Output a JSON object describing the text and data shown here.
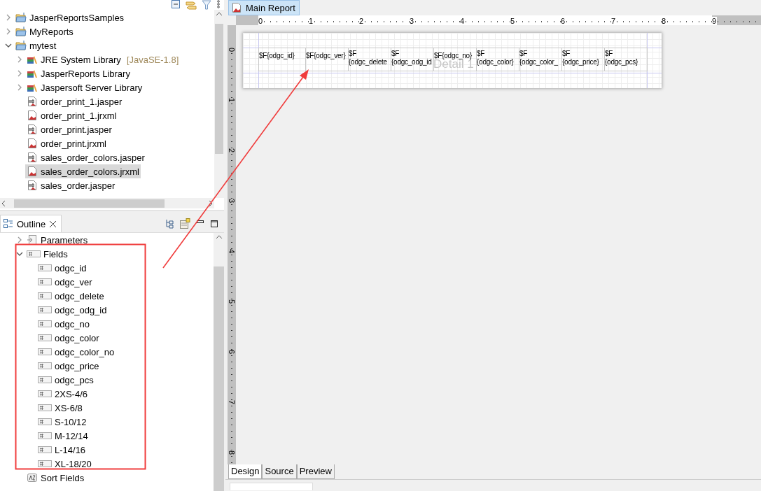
{
  "explorer": {
    "items": [
      {
        "label": "JasperReportsSamples",
        "kind": "folder",
        "expanded": false,
        "selected": false
      },
      {
        "label": "MyReports",
        "kind": "folder",
        "expanded": false,
        "selected": false
      },
      {
        "label": "mytest",
        "kind": "folder",
        "expanded": true,
        "selected": false,
        "children": [
          {
            "label": "JRE System Library",
            "decoration": "[JavaSE-1.8]",
            "kind": "library",
            "expanded": false,
            "selected": false
          },
          {
            "label": "JasperReports Library",
            "kind": "library",
            "expanded": false,
            "selected": false
          },
          {
            "label": "Jaspersoft Server Library",
            "kind": "library",
            "expanded": false,
            "selected": false
          },
          {
            "label": "order_print_1.jasper",
            "kind": "jasper",
            "selected": false
          },
          {
            "label": "order_print_1.jrxml",
            "kind": "jrxml",
            "selected": false
          },
          {
            "label": "order_print.jasper",
            "kind": "jasper",
            "selected": false
          },
          {
            "label": "order_print.jrxml",
            "kind": "jrxml",
            "selected": false
          },
          {
            "label": "sales_order_colors.jasper",
            "kind": "jasper",
            "selected": false
          },
          {
            "label": "sales_order_colors.jrxml",
            "kind": "jrxml",
            "selected": true
          },
          {
            "label": "sales_order.jasper",
            "kind": "jasper",
            "selected": false
          }
        ]
      }
    ]
  },
  "outline": {
    "title": "Outline",
    "items": [
      {
        "label": "Parameters",
        "kind": "parameters",
        "expanded": false,
        "selected": false
      },
      {
        "label": "Fields",
        "kind": "fields",
        "expanded": true,
        "selected": false,
        "children": [
          {
            "label": "odgc_id",
            "kind": "field",
            "selected": false
          },
          {
            "label": "odgc_ver",
            "kind": "field",
            "selected": false
          },
          {
            "label": "odgc_delete",
            "kind": "field",
            "selected": false
          },
          {
            "label": "odgc_odg_id",
            "kind": "field",
            "selected": false
          },
          {
            "label": "odgc_no",
            "kind": "field",
            "selected": false
          },
          {
            "label": "odgc_color",
            "kind": "field",
            "selected": false
          },
          {
            "label": "odgc_color_no",
            "kind": "field",
            "selected": false
          },
          {
            "label": "odgc_price",
            "kind": "field",
            "selected": false
          },
          {
            "label": "odgc_pcs",
            "kind": "field",
            "selected": false
          },
          {
            "label": "2XS-4/6",
            "kind": "field",
            "selected": false
          },
          {
            "label": "XS-6/8",
            "kind": "field",
            "selected": false
          },
          {
            "label": "S-10/12",
            "kind": "field",
            "selected": false
          },
          {
            "label": "M-12/14",
            "kind": "field",
            "selected": false
          },
          {
            "label": "L-14/16",
            "kind": "field",
            "selected": false
          },
          {
            "label": "XL-18/20",
            "kind": "field",
            "selected": false
          }
        ]
      },
      {
        "label": "Sort Fields",
        "kind": "sort",
        "selected": false
      }
    ]
  },
  "editor": {
    "tab": {
      "label": "Main Report",
      "selected": true
    },
    "ruler": {
      "horizontal": [
        "0",
        "1",
        "2",
        "3",
        "4",
        "5",
        "6",
        "7",
        "8",
        "9"
      ],
      "vertical": [
        "0",
        "1",
        "2",
        "3",
        "4",
        "5",
        "6",
        "7",
        "8"
      ]
    },
    "band": {
      "label": "Detail 1",
      "fields": [
        {
          "lines": [
            "$F{odgc_id}"
          ]
        },
        {
          "lines": [
            "$F{odgc_ver}"
          ]
        },
        {
          "lines": [
            "$F",
            "{odgc_delete"
          ]
        },
        {
          "lines": [
            "$F",
            "{odgc_odg_id"
          ]
        },
        {
          "lines": [
            "$F{odgc_no}"
          ]
        },
        {
          "lines": [
            "$F",
            "{odgc_color}"
          ]
        },
        {
          "lines": [
            "$F",
            "{odgc_color_"
          ]
        },
        {
          "lines": [
            "$F",
            "{odgc_price}"
          ]
        },
        {
          "lines": [
            "$F",
            "{odgc_pcs}"
          ]
        }
      ]
    },
    "bottom_tabs": [
      {
        "label": "Design",
        "selected": true
      },
      {
        "label": "Source",
        "selected": false
      },
      {
        "label": "Preview",
        "selected": false
      }
    ]
  }
}
